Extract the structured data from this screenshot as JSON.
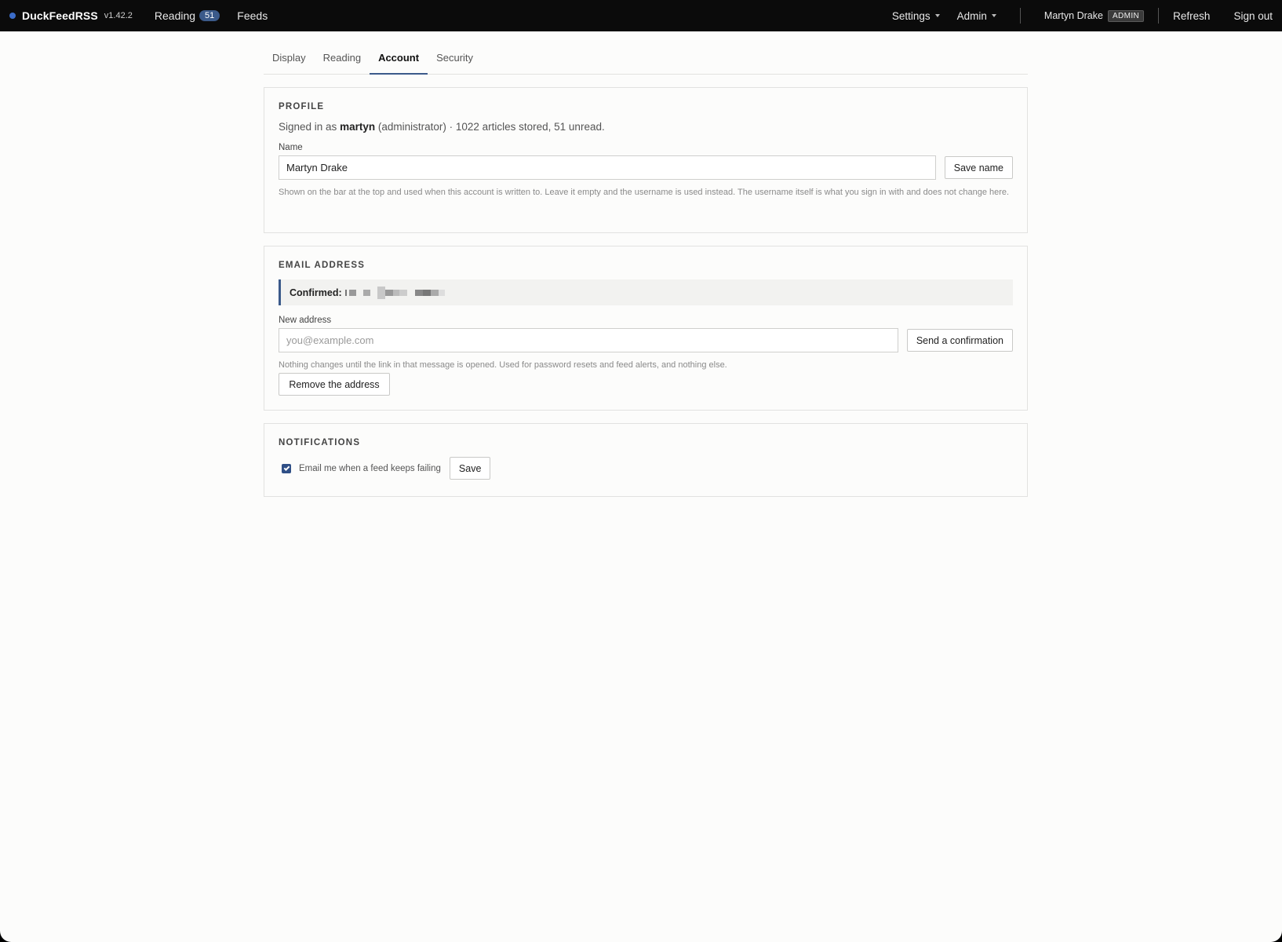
{
  "topbar": {
    "brand": "DuckFeedRSS",
    "version": "v1.42.2",
    "nav": [
      {
        "label": "Reading",
        "badge": "51"
      },
      {
        "label": "Feeds"
      }
    ],
    "settings_label": "Settings",
    "admin_label": "Admin",
    "user_name": "Martyn Drake",
    "user_role": "ADMIN",
    "refresh_label": "Refresh",
    "signout_label": "Sign out"
  },
  "tabs": [
    "Display",
    "Reading",
    "Account",
    "Security"
  ],
  "active_tab": "Account",
  "profile": {
    "title": "PROFILE",
    "signed_prefix": "Signed in as ",
    "username": "martyn",
    "signed_suffix": " (administrator) · 1022 articles stored, 51 unread.",
    "name_label": "Name",
    "name_value": "Martyn Drake",
    "save_label": "Save name",
    "help": "Shown on the bar at the top and used when this account is written to. Leave it empty and the username is used instead. The username itself is what you sign in with and does not change here."
  },
  "email": {
    "title": "EMAIL ADDRESS",
    "confirmed_label": "Confirmed: ",
    "new_label": "New address",
    "placeholder": "you@example.com",
    "send_label": "Send a confirmation",
    "help": "Nothing changes until the link in that message is opened. Used for password resets and feed alerts, and nothing else.",
    "remove_label": "Remove the address"
  },
  "notifications": {
    "title": "NOTIFICATIONS",
    "checkbox_label": "Email me when a feed keeps failing",
    "checked": true,
    "save_label": "Save"
  },
  "colors": {
    "accent": "#3b5a8a",
    "topbar": "#0b0b0b",
    "badge": "#3b5a8a"
  }
}
